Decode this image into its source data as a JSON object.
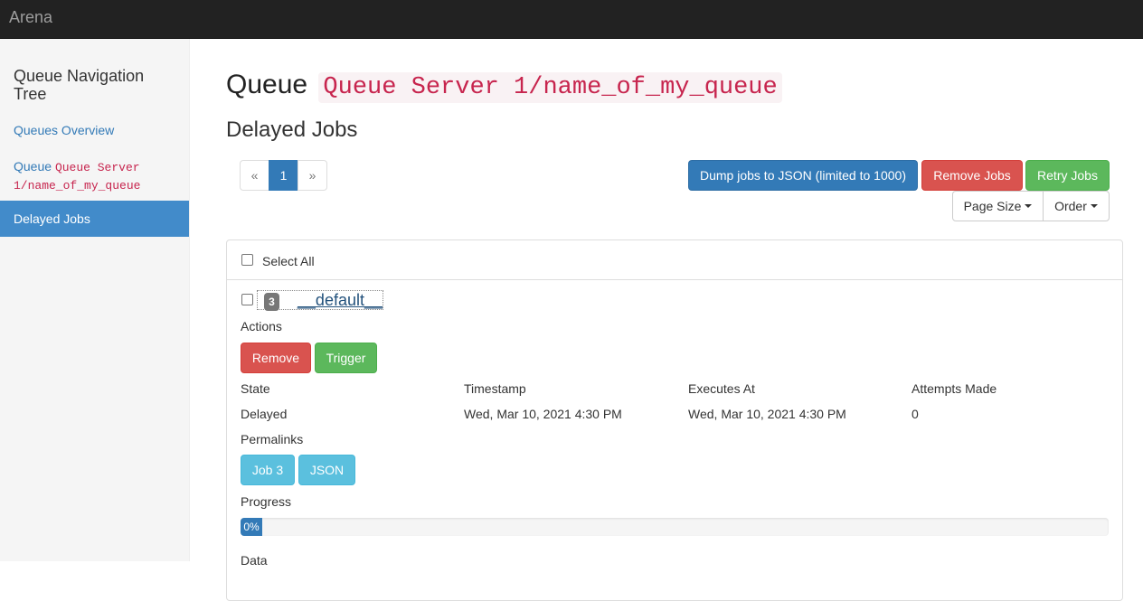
{
  "navbar": {
    "brand": "Arena"
  },
  "sidebar": {
    "title": "Queue Navigation Tree",
    "overview_link": "Queues Overview",
    "queue_prefix": "Queue",
    "queue_name_line1": "Queue Server",
    "queue_name_line2": "1/name_of_my_queue",
    "active_item": "Delayed Jobs"
  },
  "header": {
    "prefix": "Queue",
    "queue_name": "Queue Server 1/name_of_my_queue",
    "subtitle": "Delayed Jobs"
  },
  "pagination": {
    "prev": "«",
    "current": "1",
    "next": "»"
  },
  "toolbar": {
    "dump_label": "Dump jobs to JSON (limited to 1000)",
    "remove_label": "Remove Jobs",
    "retry_label": "Retry Jobs",
    "page_size_label": "Page Size",
    "order_label": "Order"
  },
  "panel": {
    "select_all": "Select All",
    "job": {
      "id_badge": "3",
      "name": "__default__",
      "actions_label": "Actions",
      "remove_label": "Remove",
      "trigger_label": "Trigger",
      "columns": [
        "State",
        "Timestamp",
        "Executes At",
        "Attempts Made"
      ],
      "values": [
        "Delayed",
        "Wed, Mar 10, 2021 4:30 PM",
        "Wed, Mar 10, 2021 4:30 PM",
        "0"
      ],
      "permalinks_label": "Permalinks",
      "permalink_job": "Job 3",
      "permalink_json": "JSON",
      "progress_label": "Progress",
      "progress_percent": 0,
      "progress_text": "0%",
      "data_label": "Data"
    }
  },
  "colors": {
    "navbar_bg": "#222222",
    "primary": "#337ab7",
    "danger": "#d9534f",
    "success": "#5cb85c",
    "info": "#5bc0de",
    "code": "#c7254e",
    "sidebar_active": "#428bca"
  }
}
